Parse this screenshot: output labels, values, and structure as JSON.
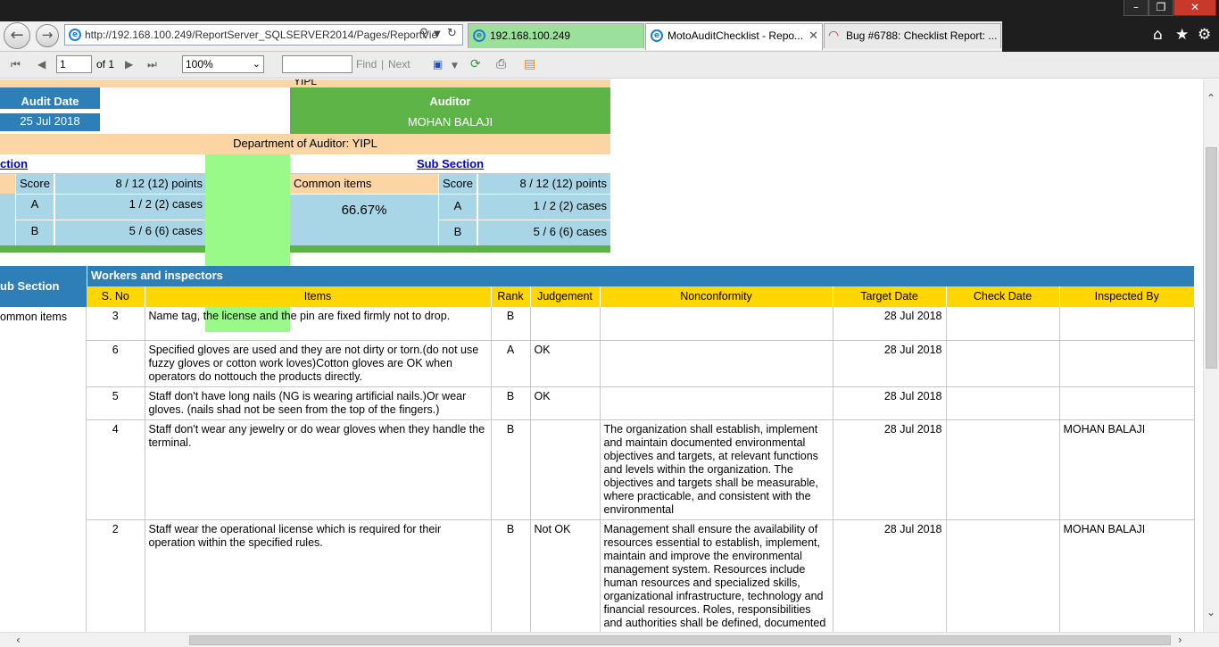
{
  "browser": {
    "url": "http://192.168.100.249/ReportServer_SQLSERVER2014/Pages/ReportVie",
    "tabs": [
      {
        "label": "192.168.100.249"
      },
      {
        "label": "MotoAuditChecklist - Repo..."
      },
      {
        "label": "Bug #6788: Checklist Report: ..."
      }
    ],
    "window_buttons": [
      "–",
      "❐",
      "✕"
    ]
  },
  "toolbar": {
    "page_current": "1",
    "page_of": "of 1",
    "zoom": "100%",
    "find_value": "",
    "find_label": "Find",
    "separator": "|",
    "next_label": "Next"
  },
  "summary": {
    "top_label": "YIPL",
    "audit_date_label": "Audit Date",
    "audit_date": "25 Jul 2018",
    "auditor_label": "Auditor",
    "auditor": "MOHAN BALAJI",
    "department": "Department of Auditor: YIPL",
    "section_link": "ction",
    "sub_section_link": "Sub Section",
    "left": {
      "score_label": "Score",
      "score": "8 / 12 (12) points",
      "rank_a": "A",
      "rank_a_cases": "1 / 2 (2) cases",
      "rank_b": "B",
      "rank_b_cases": "5 / 6 (6) cases"
    },
    "right": {
      "name": "Common items",
      "percent": "66.67%",
      "score_label": "Score",
      "score": "8 / 12 (12) points",
      "rank_a": "A",
      "rank_a_cases": "1 / 2 (2) cases",
      "rank_b": "B",
      "rank_b_cases": "5 / 6 (6) cases"
    }
  },
  "detail": {
    "sub_section_label": "ub Section",
    "group_title": "Workers and inspectors",
    "sub_section_name": "ommon items",
    "columns": [
      "S. No",
      "Items",
      "Rank",
      "Judgement",
      "Nonconformity",
      "Target Date",
      "Check Date",
      "Inspected By"
    ],
    "rows": [
      {
        "sno": "3",
        "item": "Name tag, the license and the pin are fixed firmly not to drop.",
        "rank": "B",
        "judgement": "",
        "nonconformity": "",
        "target": "28 Jul 2018",
        "check": "",
        "inspected": ""
      },
      {
        "sno": "6",
        "item": "Specified gloves are used and they are not dirty or torn.(do not use fuzzy gloves or cotton work loves)Cotton gloves are OK when operators do nottouch the products directly.",
        "rank": "A",
        "judgement": "OK",
        "nonconformity": "",
        "target": "28 Jul 2018",
        "check": "",
        "inspected": ""
      },
      {
        "sno": "5",
        "item": "Staff don't have long nails (NG is wearing artificial nails.)Or wear gloves. (nails shad not be seen from the top of the fingers.)",
        "rank": "B",
        "judgement": "OK",
        "nonconformity": "",
        "target": "28 Jul 2018",
        "check": "",
        "inspected": ""
      },
      {
        "sno": "4",
        "item": "Staff don't wear any jewelry or do wear gloves when they handle the terminal.",
        "rank": "B",
        "judgement": "",
        "nonconformity": "The organization shall establish, implement and maintain documented environmental objectives and targets, at relevant functions and levels within the organization. The objectives and targets shall be measurable, where practicable, and consistent with the environmental",
        "target": "28 Jul 2018",
        "check": "",
        "inspected": "MOHAN BALAJI"
      },
      {
        "sno": "2",
        "item": "Staff wear the operational license which is required for their operation within the specified rules.",
        "rank": "B",
        "judgement": "Not OK",
        "nonconformity": "Management shall ensure the availability of resources essential to establish, implement, maintain and improve the environmental management system. Resources include human resources and specialized skills, organizational infrastructure, technology and financial resources. Roles, responsibilities and authorities shall be defined, documented",
        "target": "28 Jul 2018",
        "check": "",
        "inspected": "MOHAN BALAJI"
      }
    ]
  },
  "colors": {
    "blue": "#2e7fb8",
    "green": "#5db346",
    "peach": "#fcd5a5",
    "light_blue": "#a9d6e6",
    "light_green": "#9afa89",
    "gold": "#ffd700"
  }
}
